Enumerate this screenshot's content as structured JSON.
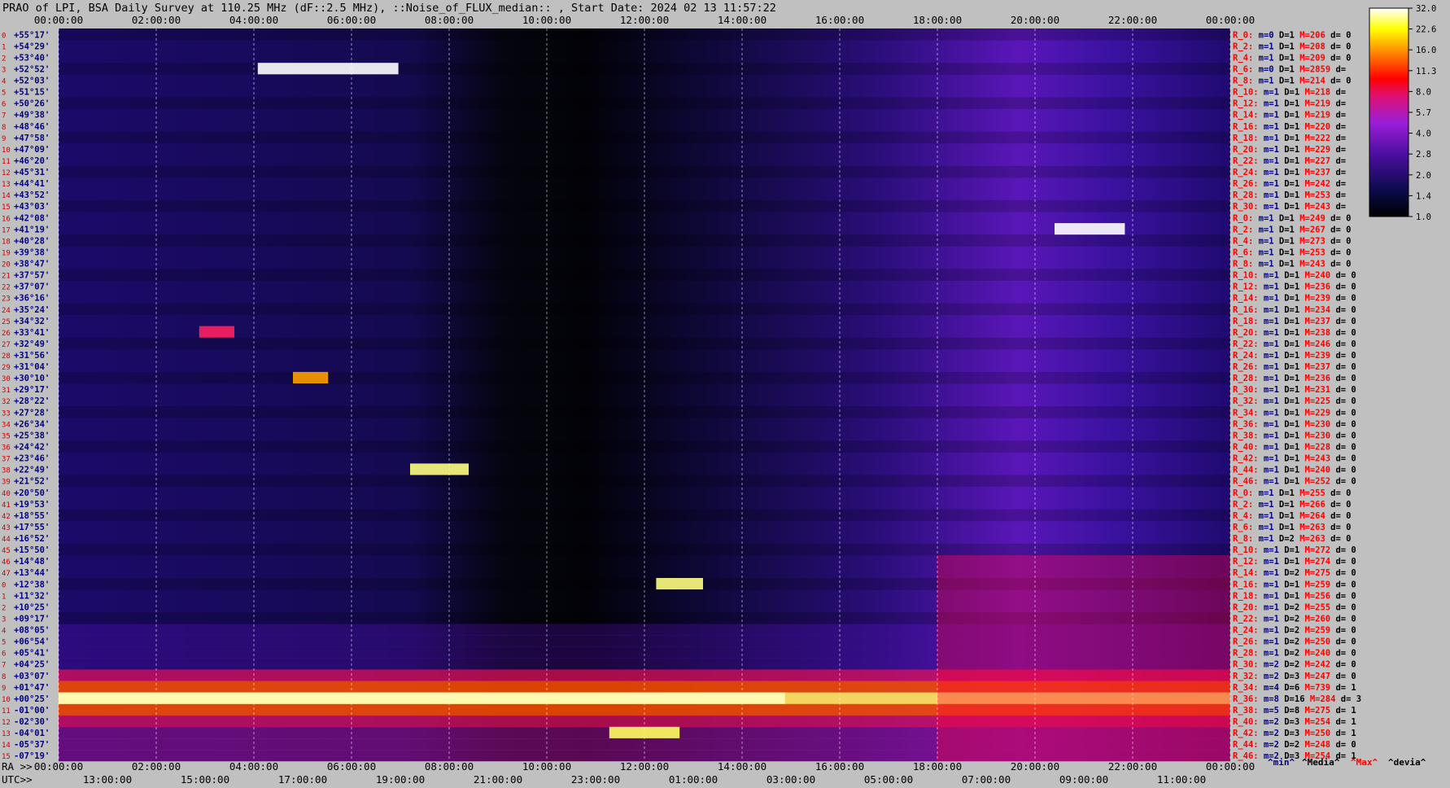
{
  "title": "PRAO of LPI, BSA Daily Survey at 110.25 MHz (dF::2.5 MHz), ::Noise_of_FLUX_median:: , Start Date: 2024 02 13 11:57:22",
  "footer": {
    "ra_label": "RA >>",
    "utc_label": "UTC>>"
  },
  "chart_data": {
    "type": "heatmap",
    "title": "PRAO of LPI, BSA Daily Survey at 110.25 MHz (dF::2.5 MHz), ::Noise_of_FLUX_median:: , Start Date: 2024 02 13 11:57:22",
    "x_top_ticks": [
      "00:00:00",
      "02:00:00",
      "04:00:00",
      "06:00:00",
      "08:00:00",
      "10:00:00",
      "12:00:00",
      "14:00:00",
      "16:00:00",
      "18:00:00",
      "20:00:00",
      "22:00:00",
      "00:00:00"
    ],
    "x_ra_ticks": [
      "00:00:00",
      "02:00:00",
      "04:00:00",
      "06:00:00",
      "08:00:00",
      "10:00:00",
      "12:00:00",
      "14:00:00",
      "16:00:00",
      "18:00:00",
      "20:00:00",
      "22:00:00",
      "00:00:00"
    ],
    "x_utc_ticks": [
      "13:00:00",
      "15:00:00",
      "17:00:00",
      "19:00:00",
      "21:00:00",
      "23:00:00",
      "01:00:00",
      "03:00:00",
      "05:00:00",
      "07:00:00",
      "09:00:00",
      "11:00:00"
    ],
    "declinations": [
      "+55°17'",
      "+54°29'",
      "+53°40'",
      "+52°52'",
      "+52°03'",
      "+51°15'",
      "+50°26'",
      "+49°38'",
      "+48°46'",
      "+47°58'",
      "+47°09'",
      "+46°20'",
      "+45°31'",
      "+44°41'",
      "+43°52'",
      "+43°03'",
      "+42°08'",
      "+41°19'",
      "+40°28'",
      "+39°38'",
      "+38°47'",
      "+37°57'",
      "+37°07'",
      "+36°16'",
      "+35°24'",
      "+34°32'",
      "+33°41'",
      "+32°49'",
      "+31°56'",
      "+31°04'",
      "+30°10'",
      "+29°17'",
      "+28°22'",
      "+27°28'",
      "+26°34'",
      "+25°38'",
      "+24°42'",
      "+23°46'",
      "+22°49'",
      "+21°52'",
      "+20°50'",
      "+19°53'",
      "+18°55'",
      "+17°55'",
      "+16°52'",
      "+15°50'",
      "+14°48'",
      "+13°44'",
      "+12°38'",
      "+11°32'",
      "+10°25'",
      "+09°17'",
      "+08°05'",
      "+06°54'",
      "+05°41'",
      "+04°25'",
      "+03°07'",
      "+01°47'",
      "+00°25'",
      "-01°00'",
      "-02°30'",
      "-04°01'",
      "-05°37'",
      "-07°19'"
    ],
    "colorbar": {
      "ticks": [
        "32.0",
        "22.6",
        "16.0",
        "11.3",
        "8.0",
        "5.7",
        "4.0",
        "2.8",
        "2.0",
        "1.4",
        "1.0"
      ],
      "min": 1.0,
      "max": 32.0,
      "scale": "log"
    },
    "row_stats": [
      {
        "r": "R_0:",
        "m": "m=0",
        "D": "D=1",
        "M": "M=206",
        "d": "d= 0"
      },
      {
        "r": "R_2:",
        "m": "m=1",
        "D": "D=1",
        "M": "M=208",
        "d": "d= 0"
      },
      {
        "r": "R_4:",
        "m": "m=1",
        "D": "D=1",
        "M": "M=209",
        "d": "d= 0"
      },
      {
        "r": "R_6:",
        "m": "m=0",
        "D": "D=1",
        "M": "M=2859",
        "d": "d="
      },
      {
        "r": "R_8:",
        "m": "m=1",
        "D": "D=1",
        "M": "M=214",
        "d": "d= 0"
      },
      {
        "r": "R_10:",
        "m": "m=1",
        "D": "D=1",
        "M": "M=218",
        "d": "d="
      },
      {
        "r": "R_12:",
        "m": "m=1",
        "D": "D=1",
        "M": "M=219",
        "d": "d="
      },
      {
        "r": "R_14:",
        "m": "m=1",
        "D": "D=1",
        "M": "M=219",
        "d": "d="
      },
      {
        "r": "R_16:",
        "m": "m=1",
        "D": "D=1",
        "M": "M=220",
        "d": "d="
      },
      {
        "r": "R_18:",
        "m": "m=1",
        "D": "D=1",
        "M": "M=222",
        "d": "d="
      },
      {
        "r": "R_20:",
        "m": "m=1",
        "D": "D=1",
        "M": "M=229",
        "d": "d="
      },
      {
        "r": "R_22:",
        "m": "m=1",
        "D": "D=1",
        "M": "M=227",
        "d": "d="
      },
      {
        "r": "R_24:",
        "m": "m=1",
        "D": "D=1",
        "M": "M=237",
        "d": "d="
      },
      {
        "r": "R_26:",
        "m": "m=1",
        "D": "D=1",
        "M": "M=242",
        "d": "d="
      },
      {
        "r": "R_28:",
        "m": "m=1",
        "D": "D=1",
        "M": "M=253",
        "d": "d="
      },
      {
        "r": "R_30:",
        "m": "m=1",
        "D": "D=1",
        "M": "M=243",
        "d": "d="
      },
      {
        "r": "R_0:",
        "m": "m=1",
        "D": "D=1",
        "M": "M=249",
        "d": "d= 0"
      },
      {
        "r": "R_2:",
        "m": "m=1",
        "D": "D=1",
        "M": "M=267",
        "d": "d= 0"
      },
      {
        "r": "R_4:",
        "m": "m=1",
        "D": "D=1",
        "M": "M=273",
        "d": "d= 0"
      },
      {
        "r": "R_6:",
        "m": "m=1",
        "D": "D=1",
        "M": "M=253",
        "d": "d= 0"
      },
      {
        "r": "R_8:",
        "m": "m=1",
        "D": "D=1",
        "M": "M=243",
        "d": "d= 0"
      },
      {
        "r": "R_10:",
        "m": "m=1",
        "D": "D=1",
        "M": "M=240",
        "d": "d= 0"
      },
      {
        "r": "R_12:",
        "m": "m=1",
        "D": "D=1",
        "M": "M=236",
        "d": "d= 0"
      },
      {
        "r": "R_14:",
        "m": "m=1",
        "D": "D=1",
        "M": "M=239",
        "d": "d= 0"
      },
      {
        "r": "R_16:",
        "m": "m=1",
        "D": "D=1",
        "M": "M=234",
        "d": "d= 0"
      },
      {
        "r": "R_18:",
        "m": "m=1",
        "D": "D=1",
        "M": "M=237",
        "d": "d= 0"
      },
      {
        "r": "R_20:",
        "m": "m=1",
        "D": "D=1",
        "M": "M=238",
        "d": "d= 0"
      },
      {
        "r": "R_22:",
        "m": "m=1",
        "D": "D=1",
        "M": "M=246",
        "d": "d= 0"
      },
      {
        "r": "R_24:",
        "m": "m=1",
        "D": "D=1",
        "M": "M=239",
        "d": "d= 0"
      },
      {
        "r": "R_26:",
        "m": "m=1",
        "D": "D=1",
        "M": "M=237",
        "d": "d= 0"
      },
      {
        "r": "R_28:",
        "m": "m=1",
        "D": "D=1",
        "M": "M=236",
        "d": "d= 0"
      },
      {
        "r": "R_30:",
        "m": "m=1",
        "D": "D=1",
        "M": "M=231",
        "d": "d= 0"
      },
      {
        "r": "R_32:",
        "m": "m=1",
        "D": "D=1",
        "M": "M=225",
        "d": "d= 0"
      },
      {
        "r": "R_34:",
        "m": "m=1",
        "D": "D=1",
        "M": "M=229",
        "d": "d= 0"
      },
      {
        "r": "R_36:",
        "m": "m=1",
        "D": "D=1",
        "M": "M=230",
        "d": "d= 0"
      },
      {
        "r": "R_38:",
        "m": "m=1",
        "D": "D=1",
        "M": "M=230",
        "d": "d= 0"
      },
      {
        "r": "R_40:",
        "m": "m=1",
        "D": "D=1",
        "M": "M=228",
        "d": "d= 0"
      },
      {
        "r": "R_42:",
        "m": "m=1",
        "D": "D=1",
        "M": "M=243",
        "d": "d= 0"
      },
      {
        "r": "R_44:",
        "m": "m=1",
        "D": "D=1",
        "M": "M=240",
        "d": "d= 0"
      },
      {
        "r": "R_46:",
        "m": "m=1",
        "D": "D=1",
        "M": "M=252",
        "d": "d= 0"
      },
      {
        "r": "R_0:",
        "m": "m=1",
        "D": "D=1",
        "M": "M=255",
        "d": "d= 0"
      },
      {
        "r": "R_2:",
        "m": "m=1",
        "D": "D=1",
        "M": "M=266",
        "d": "d= 0"
      },
      {
        "r": "R_4:",
        "m": "m=1",
        "D": "D=1",
        "M": "M=264",
        "d": "d= 0"
      },
      {
        "r": "R_6:",
        "m": "m=1",
        "D": "D=1",
        "M": "M=263",
        "d": "d= 0"
      },
      {
        "r": "R_8:",
        "m": "m=1",
        "D": "D=2",
        "M": "M=263",
        "d": "d= 0"
      },
      {
        "r": "R_10:",
        "m": "m=1",
        "D": "D=1",
        "M": "M=272",
        "d": "d= 0"
      },
      {
        "r": "R_12:",
        "m": "m=1",
        "D": "D=1",
        "M": "M=274",
        "d": "d= 0"
      },
      {
        "r": "R_14:",
        "m": "m=1",
        "D": "D=2",
        "M": "M=275",
        "d": "d= 0"
      },
      {
        "r": "R_16:",
        "m": "m=1",
        "D": "D=1",
        "M": "M=259",
        "d": "d= 0"
      },
      {
        "r": "R_18:",
        "m": "m=1",
        "D": "D=1",
        "M": "M=256",
        "d": "d= 0"
      },
      {
        "r": "R_20:",
        "m": "m=1",
        "D": "D=2",
        "M": "M=255",
        "d": "d= 0"
      },
      {
        "r": "R_22:",
        "m": "m=1",
        "D": "D=2",
        "M": "M=260",
        "d": "d= 0"
      },
      {
        "r": "R_24:",
        "m": "m=1",
        "D": "D=2",
        "M": "M=259",
        "d": "d= 0"
      },
      {
        "r": "R_26:",
        "m": "m=1",
        "D": "D=2",
        "M": "M=250",
        "d": "d= 0"
      },
      {
        "r": "R_28:",
        "m": "m=1",
        "D": "D=2",
        "M": "M=240",
        "d": "d= 0"
      },
      {
        "r": "R_30:",
        "m": "m=2",
        "D": "D=2",
        "M": "M=242",
        "d": "d= 0"
      },
      {
        "r": "R_32:",
        "m": "m=2",
        "D": "D=3",
        "M": "M=247",
        "d": "d= 0"
      },
      {
        "r": "R_34:",
        "m": "m=4",
        "D": "D=6",
        "M": "M=739",
        "d": "d= 1"
      },
      {
        "r": "R_36:",
        "m": "m=8",
        "D": "D=16",
        "M": "M=284",
        "d": "d= 3"
      },
      {
        "r": "R_38:",
        "m": "m=5",
        "D": "D=8",
        "M": "M=275",
        "d": "d= 1"
      },
      {
        "r": "R_40:",
        "m": "m=2",
        "D": "D=3",
        "M": "M=254",
        "d": "d= 1"
      },
      {
        "r": "R_42:",
        "m": "m=2",
        "D": "D=3",
        "M": "M=250",
        "d": "d= 1"
      },
      {
        "r": "R_44:",
        "m": "m=2",
        "D": "D=2",
        "M": "M=248",
        "d": "d= 0"
      },
      {
        "r": "R_46:",
        "m": "m=2",
        "D": "D=3",
        "M": "M=254",
        "d": "d= 1"
      }
    ],
    "stats_legend": [
      "^min^",
      "^Media^",
      "^Max^",
      "^devia^"
    ],
    "colors": {
      "m": "#000080",
      "D": "#000000",
      "M": "#ff0000",
      "d": "#000000",
      "r": "#ff0000"
    }
  }
}
